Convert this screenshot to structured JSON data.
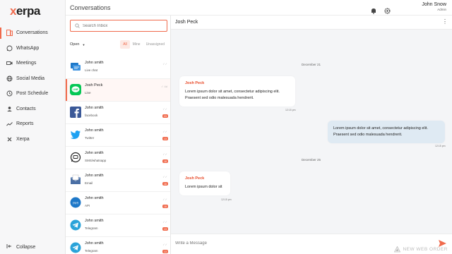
{
  "app": {
    "logo": "xerpa",
    "logo_first": "x",
    "logo_rest": "erpa"
  },
  "sidebar": {
    "items": [
      {
        "label": "Conversations",
        "icon": "conversations-icon",
        "active": true
      },
      {
        "label": "WhatsApp",
        "icon": "whatsapp-icon"
      },
      {
        "label": "Meetings",
        "icon": "meetings-icon"
      },
      {
        "label": "Social Media",
        "icon": "social-media-icon"
      },
      {
        "label": "Post Schedule",
        "icon": "post-schedule-icon"
      },
      {
        "label": "Contacts",
        "icon": "contacts-icon"
      },
      {
        "label": "Reports",
        "icon": "reports-icon"
      },
      {
        "label": "Xerpa",
        "icon": "xerpa-icon"
      }
    ],
    "collapse_label": "Collapse"
  },
  "header": {
    "title": "Conversations",
    "user_name": "John Snow",
    "user_role": "Admin"
  },
  "list": {
    "search_placeholder": "Search Inbox",
    "status_filter": "Open",
    "tabs": [
      "All",
      "Mine",
      "Unassigned"
    ],
    "active_tab": "All",
    "conversations": [
      {
        "name": "John smith",
        "channel": "Live chat",
        "ticks": "✓✓",
        "badge": "",
        "icon": "live-chat-icon"
      },
      {
        "name": "Josh Peck",
        "channel": "Line",
        "ticks": "✓ 4d",
        "badge": "",
        "icon": "line-icon",
        "active": true
      },
      {
        "name": "John smith",
        "channel": "facebook",
        "ticks": "✓✓",
        "badge": "23",
        "icon": "facebook-icon"
      },
      {
        "name": "John smith",
        "channel": "Twitter",
        "ticks": "✓✓",
        "badge": "13",
        "icon": "twitter-icon"
      },
      {
        "name": "John smith",
        "channel": "SMS/whatsapp",
        "ticks": "✓✓",
        "badge": "18",
        "icon": "sms-whatsapp-icon"
      },
      {
        "name": "John smith",
        "channel": "Email",
        "ticks": "✓✓",
        "badge": "16",
        "icon": "email-icon"
      },
      {
        "name": "John smith",
        "channel": "API",
        "ticks": "✓✓",
        "badge": "18",
        "icon": "api-icon"
      },
      {
        "name": "John smith",
        "channel": "Telegram",
        "ticks": "✓✓",
        "badge": "13",
        "icon": "telegram-icon"
      },
      {
        "name": "John smith",
        "channel": "Telegram",
        "ticks": "✓✓",
        "badge": "13",
        "icon": "telegram-icon"
      }
    ]
  },
  "chat": {
    "contact_name": "Josh Peck",
    "messages": [
      {
        "date": "December 21"
      },
      {
        "from": "Josh Peck",
        "text": "Lorem ipsum dolor sit amet, consectetur adipiscing elit. Praesent sed odio  malesuada hendrerit.",
        "time": "12:15 pm",
        "direction": "in"
      },
      {
        "text": "Lorem ipsum dolor sit amet, consectetur adipiscing elit. Praesent sed odio  malesuada hendrerit.",
        "time": "12:15 pm",
        "direction": "out"
      },
      {
        "date": "December 25"
      },
      {
        "from": "Josh Peck",
        "text": "Lorem ipsum dolor sit",
        "time": "12:15 pm",
        "direction": "in"
      }
    ],
    "composer_placeholder": "Write a Message"
  },
  "watermark": "NEW WEB ORDER",
  "colors": {
    "accent": "#f06a4c",
    "outgoing_bubble": "#dfeaf3",
    "background": "#f4f5f7"
  }
}
